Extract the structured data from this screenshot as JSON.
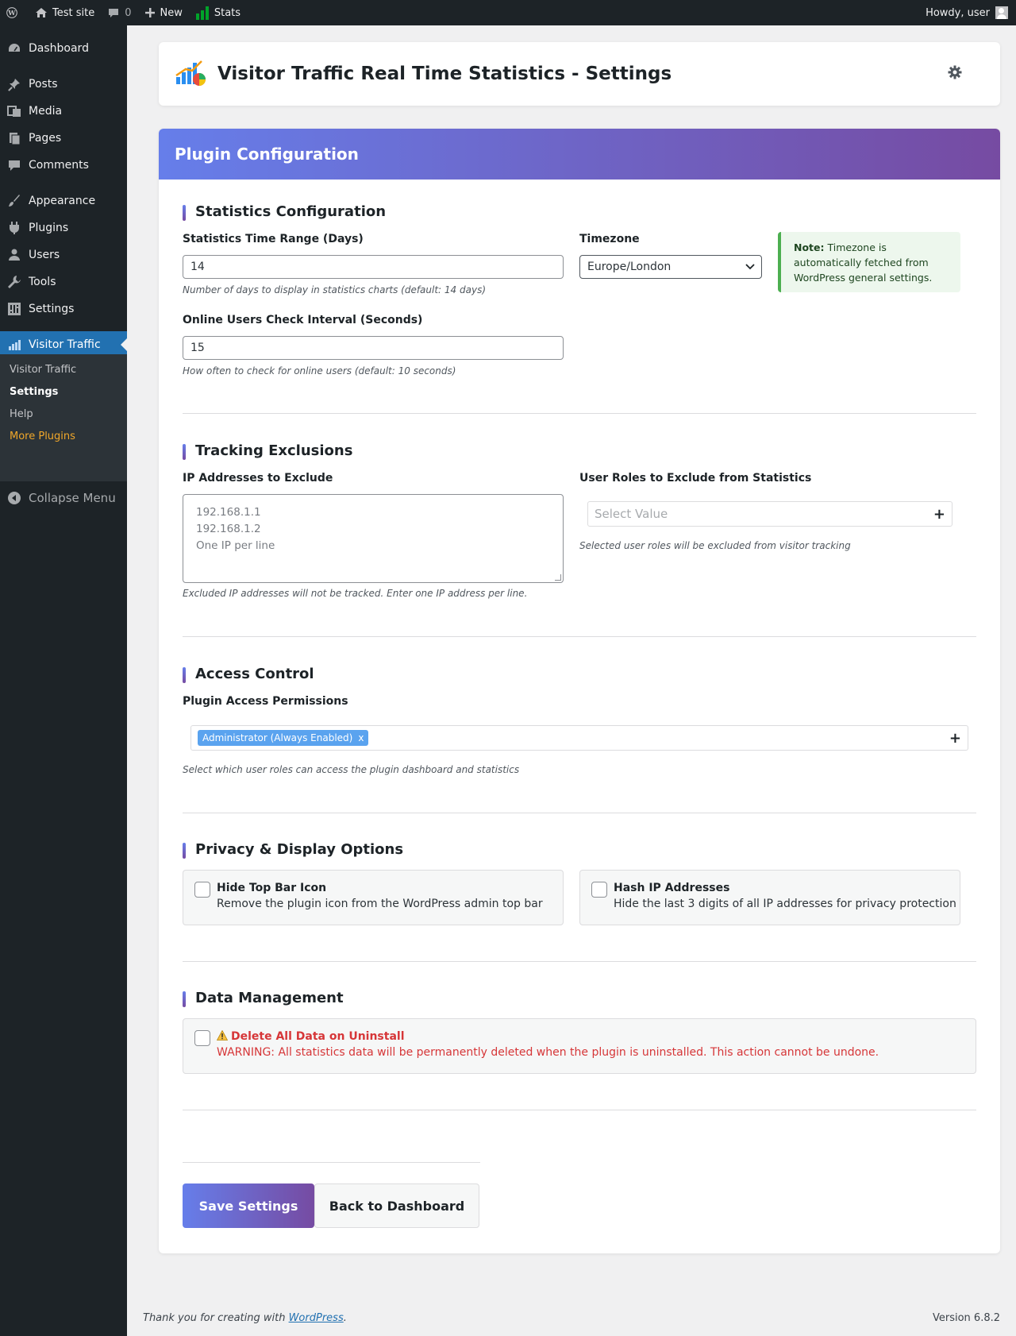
{
  "adminbar": {
    "site_name": "Test site",
    "comments_count": "0",
    "new_label": "New",
    "stats_label": "Stats",
    "howdy": "Howdy, user"
  },
  "sidebar": {
    "items": [
      {
        "label": "Dashboard",
        "icon": "dashboard-icon"
      },
      {
        "label": "Posts",
        "icon": "pushpin-icon"
      },
      {
        "label": "Media",
        "icon": "media-icon"
      },
      {
        "label": "Pages",
        "icon": "pages-icon"
      },
      {
        "label": "Comments",
        "icon": "comment-icon"
      },
      {
        "label": "Appearance",
        "icon": "brush-icon"
      },
      {
        "label": "Plugins",
        "icon": "plugin-icon"
      },
      {
        "label": "Users",
        "icon": "user-icon"
      },
      {
        "label": "Tools",
        "icon": "wrench-icon"
      },
      {
        "label": "Settings",
        "icon": "settings-icon"
      },
      {
        "label": "Visitor Traffic",
        "icon": "chart-icon"
      }
    ],
    "submenu": [
      "Visitor Traffic",
      "Settings",
      "Help",
      "More Plugins"
    ],
    "collapse": "Collapse Menu"
  },
  "header": {
    "title": "Visitor Traffic Real Time Statistics - Settings"
  },
  "config": {
    "heading": "Plugin Configuration",
    "stats_section": {
      "title": "Statistics Configuration",
      "range_label": "Statistics Time Range (Days)",
      "range_value": "14",
      "range_hint": "Number of days to display in statistics charts (default: 14 days)",
      "timezone_label": "Timezone",
      "timezone_value": "Europe/London",
      "note_bold": "Note:",
      "note_text": "Timezone is automatically fetched from WordPress general settings.",
      "interval_label": "Online Users Check Interval (Seconds)",
      "interval_value": "15",
      "interval_hint": "How often to check for online users (default: 10 seconds)"
    },
    "exclusions": {
      "title": "Tracking Exclusions",
      "ip_label": "IP Addresses to Exclude",
      "ip_placeholder_lines": [
        "192.168.1.1",
        "192.168.1.2",
        "One IP per line"
      ],
      "ip_hint": "Excluded IP addresses will not be tracked. Enter one IP address per line.",
      "roles_label": "User Roles to Exclude from Statistics",
      "roles_placeholder": "Select Value",
      "roles_hint": "Selected user roles will be excluded from visitor tracking"
    },
    "access": {
      "title": "Access Control",
      "perm_label": "Plugin Access Permissions",
      "chip": "Administrator (Always Enabled)",
      "chip_remove": "x",
      "perm_hint": "Select which user roles can access the plugin dashboard and statistics"
    },
    "privacy": {
      "title": "Privacy & Display Options",
      "hide_icon_title": "Hide Top Bar Icon",
      "hide_icon_desc": "Remove the plugin icon from the WordPress admin top bar",
      "hide_icon_checked": false,
      "hash_ip_title": "Hash IP Addresses",
      "hash_ip_desc": "Hide the last 3 digits of all IP addresses for privacy protection",
      "hash_ip_checked": false
    },
    "data_mgmt": {
      "title": "Data Management",
      "delete_title": "Delete All Data on Uninstall",
      "delete_desc": "WARNING: All statistics data will be permanently deleted when the plugin is uninstalled. This action cannot be undone.",
      "delete_checked": false
    },
    "buttons": {
      "save": "Save Settings",
      "back": "Back to Dashboard"
    }
  },
  "footer": {
    "thanks_prefix": "Thank you for creating with ",
    "thanks_link": "WordPress",
    "thanks_suffix": ".",
    "version": "Version 6.8.2"
  },
  "colors": {
    "accent_gradient_start": "#667eea",
    "accent_gradient_end": "#764ba2",
    "wp_blue": "#2271b1",
    "admin_dark": "#1d2327",
    "danger": "#d63638",
    "note_green": "#4caf50"
  }
}
